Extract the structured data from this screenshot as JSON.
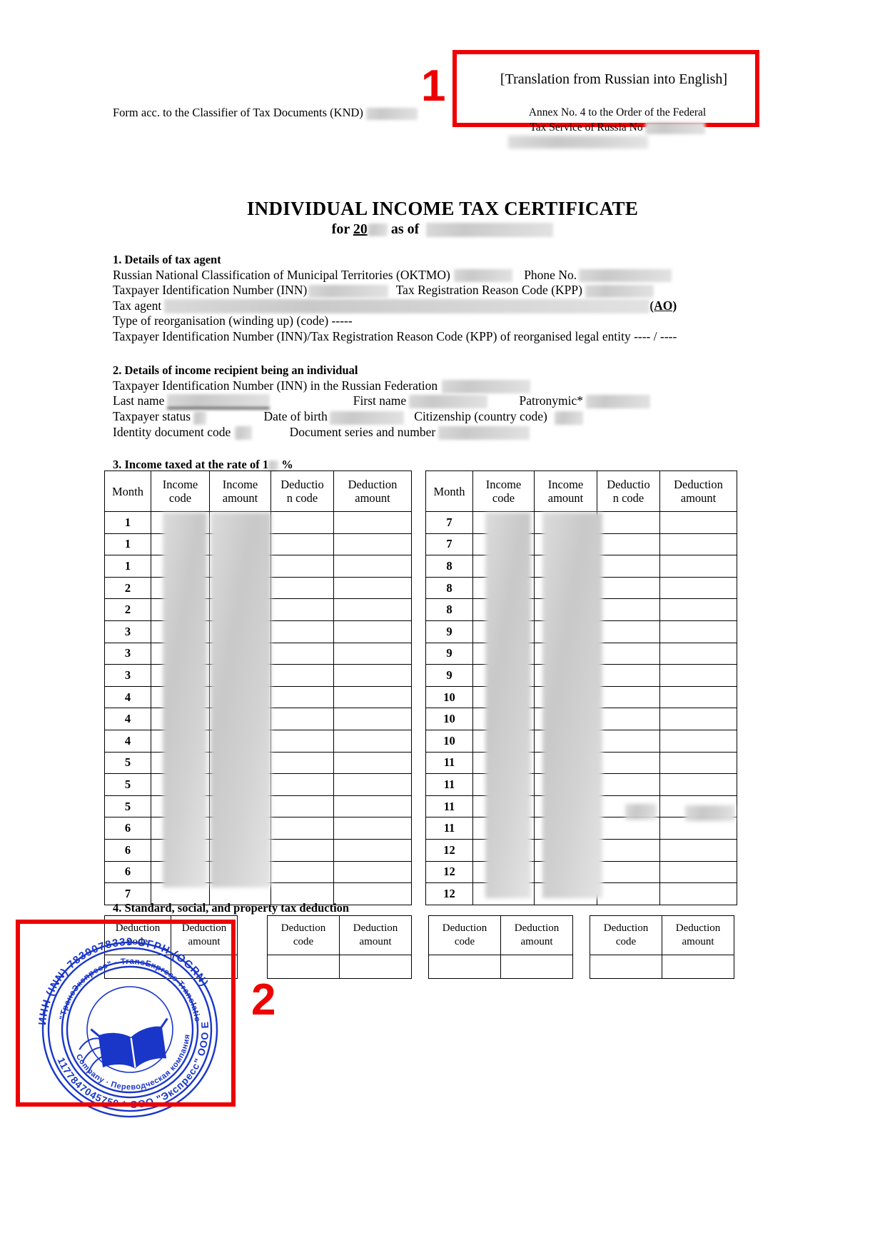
{
  "header": {
    "translation_note": "[Translation from Russian into English]",
    "left_label": "Form acc. to the Classifier of Tax Documents (KND)",
    "annex_line1": "Annex No. 4 to the Order of the Federal",
    "annex_line2": "Tax Service of Russia No"
  },
  "annotations": {
    "marker_1": "1",
    "marker_2": "2",
    "marker_color": "#ee0000"
  },
  "title": {
    "main": "INDIVIDUAL INCOME TAX CERTIFICATE",
    "for_label": "for",
    "year_prefix": "20",
    "as_of_label": "as of"
  },
  "section1": {
    "heading": "1. Details of tax agent",
    "oktmo_label": "Russian National Classification of Municipal Territories (OKTMO)",
    "phone_label": "Phone No.",
    "inn_label": "Taxpayer Identification Number (INN)",
    "kpp_label": "Tax Registration Reason Code (KPP)",
    "tax_agent_label": "Tax agent",
    "tax_agent_suffix": "(AO)",
    "reorg_label": "Type of reorganisation (winding up) (code) -----",
    "reorg_inn_kpp_label": "Taxpayer Identification Number (INN)/Tax Registration Reason Code (KPP) of reorganised legal entity ---- / ----"
  },
  "section2": {
    "heading": "2. Details of income recipient being an individual",
    "inn_rf_label": "Taxpayer Identification Number (INN) in the Russian Federation",
    "last_name_label": "Last name",
    "first_name_label": "First name",
    "patronymic_label": "Patronymic*",
    "taxpayer_status_label": "Taxpayer status",
    "date_of_birth_label": "Date of birth",
    "citizenship_label": "Citizenship (country code)",
    "identity_doc_label": "Identity document code",
    "doc_series_label": "Document series and number"
  },
  "section3": {
    "heading_prefix": "3. Income taxed at the rate of",
    "rate_visible": "1",
    "heading_suffix": "%",
    "columns": [
      "Month",
      "Income code",
      "Income amount",
      "Deduction code",
      "Deduction amount"
    ],
    "columns_wrapped": [
      "Month",
      "Income\ncode",
      "Income\namount",
      "Deductio\nn code",
      "Deduction\namount"
    ],
    "left_months": [
      "1",
      "1",
      "1",
      "2",
      "2",
      "3",
      "3",
      "3",
      "4",
      "4",
      "4",
      "5",
      "5",
      "5",
      "6",
      "6",
      "6",
      "7"
    ],
    "right_months": [
      "7",
      "7",
      "8",
      "8",
      "8",
      "9",
      "9",
      "9",
      "10",
      "10",
      "10",
      "11",
      "11",
      "11",
      "11",
      "12",
      "12",
      "12"
    ]
  },
  "section4": {
    "heading": "4. Standard, social, and property tax deduction",
    "columns": [
      "Deduction code",
      "Deduction amount"
    ],
    "table_count": 4
  },
  "stamp": {
    "outer_text_top": "ООО Express) ИНН (INN) 7839078339 ОГРН (OGRN) 1177847045750 * ООО",
    "inner_text": "Переводческая компания \"ТрансЭкспресс\" · TransExpress Translation Company",
    "color": "#1a36c8"
  }
}
